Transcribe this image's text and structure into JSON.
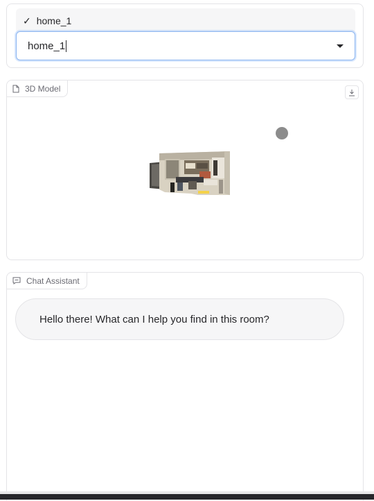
{
  "dropdown": {
    "selected_option": "home_1",
    "check_mark": "✓",
    "input_value": "home_1",
    "arrow_icon": "dropdown-arrow-icon"
  },
  "model_viewer": {
    "label": "3D Model",
    "label_icon": "file-icon",
    "download_icon": "download-icon"
  },
  "chat": {
    "label": "Chat Assistant",
    "label_icon": "chat-icon",
    "messages": [
      {
        "role": "assistant",
        "text": "Hello there! What can I help you find in this room?"
      }
    ]
  },
  "colors": {
    "accent_border": "#8ab4f0",
    "card_border": "#e4e4e7",
    "bubble_bg": "#f6f6f7"
  }
}
